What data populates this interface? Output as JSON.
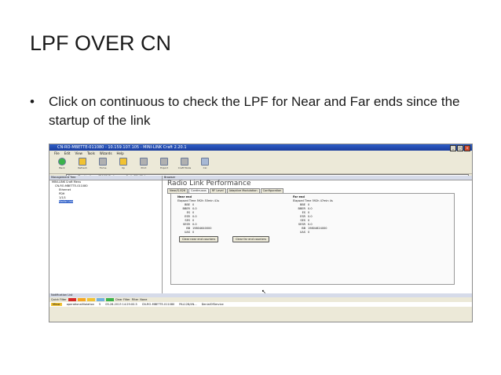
{
  "slide": {
    "title": "LPF OVER CN",
    "bullet": "•",
    "text": "Click on continuous to check the LPF for Near and Far ends since the startup of the link"
  },
  "window": {
    "title": "CN-RO-MBETTE-011080 - 10.159.107.105 - MINI-LINK Craft 2.20.1",
    "buttons": [
      "_",
      "□",
      "×"
    ],
    "menu": [
      "File",
      "Edit",
      "View",
      "Tools",
      "Wizards",
      "Help"
    ],
    "toolbar": [
      "Back",
      "Refresh",
      "Home",
      "Up",
      "Print",
      "Export",
      "Craft Mode",
      "CLI"
    ],
    "address_label": "Address",
    "address": "Frame:@...rties/home/PM/CN/PerformanceRadioPM_CN.frame"
  },
  "tree": {
    "header": "Management Tree",
    "items": [
      {
        "label": "MINI-LINK Craft Menu",
        "indent": 0,
        "selected": false
      },
      {
        "label": "CN-RO-MBETTE-011080",
        "indent": 1,
        "selected": false
      },
      {
        "label": "Ethernet",
        "indent": 2,
        "selected": false
      },
      {
        "label": "PDH",
        "indent": 2,
        "selected": false
      },
      {
        "label": "1/1/1",
        "indent": 2,
        "selected": false
      },
      {
        "label": "Radio Link",
        "indent": 2,
        "selected": true
      }
    ]
  },
  "browser": {
    "header": "Browser",
    "title": "Radio Link Performance",
    "tabs": [
      "Near/G.826",
      "Continuous",
      "RF Level",
      "Adaptive Modulation",
      "Configuration"
    ],
    "active_tab": "Continuous"
  },
  "near": {
    "head": "Near end",
    "elapsed_label": "Elapsed Time",
    "elapsed": "592h 53min 41s",
    "metrics": [
      {
        "k": "BBE",
        "v": "0"
      },
      {
        "k": "BBER",
        "v": "0.0"
      },
      {
        "k": "ES",
        "v": "0"
      },
      {
        "k": "ESR",
        "v": "0.0"
      },
      {
        "k": "SES",
        "v": "0"
      },
      {
        "k": "SESR",
        "v": "0.0"
      },
      {
        "k": "BB",
        "v": "19804640000"
      },
      {
        "k": "UAS",
        "v": "0"
      }
    ],
    "clear_label": "Clear near end counters"
  },
  "far": {
    "head": "Far end",
    "elapsed_label": "Elapsed Time",
    "elapsed": "592h 47min 4s",
    "metrics": [
      {
        "k": "BBE",
        "v": "0"
      },
      {
        "k": "BBER",
        "v": "0.0"
      },
      {
        "k": "ES",
        "v": "0"
      },
      {
        "k": "ESR",
        "v": "0.0"
      },
      {
        "k": "SES",
        "v": "0"
      },
      {
        "k": "SESR",
        "v": "0.0"
      },
      {
        "k": "BB",
        "v": "19804624000"
      },
      {
        "k": "UAS",
        "v": "0"
      }
    ],
    "clear_label": "Clear far end counters"
  },
  "notifications": {
    "header": "Notification List",
    "quick_filter": "Quick Filter",
    "clear_filter": "Clear Filter",
    "filter_label": "Filter",
    "filter_value": "None",
    "severity_colors": [
      "#d62728",
      "#f5a623",
      "#f1c232",
      "#6fb1e0",
      "#3bb34a"
    ],
    "alarm": {
      "severity": "Minor",
      "type": "operationalViolation",
      "count": "5",
      "time": "05-28-2013 14:29:00.5",
      "source": "CN-RO-MBETTE-011080",
      "object": "PAL128/4N...",
      "text": "DenialOfService"
    }
  }
}
